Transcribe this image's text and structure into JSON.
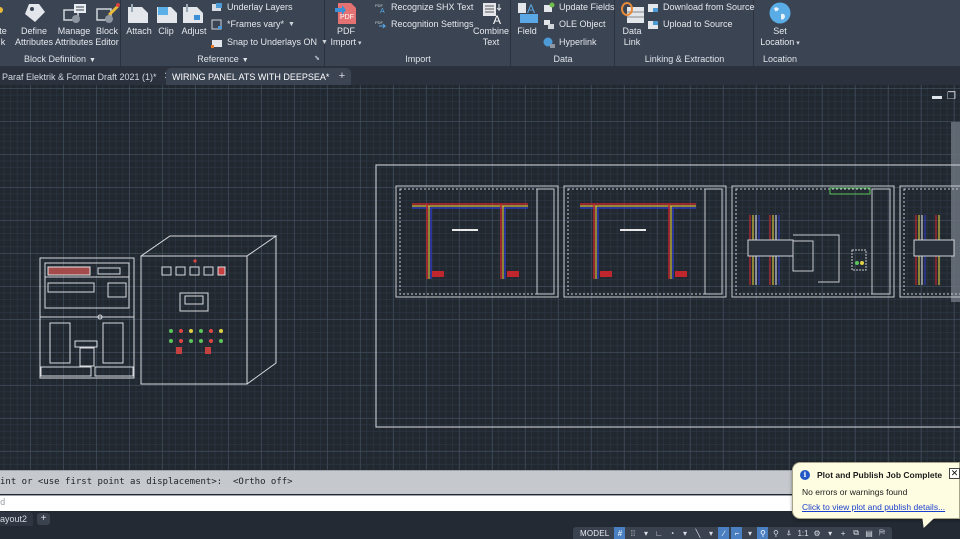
{
  "ribbon": {
    "panels": {
      "block_definition": {
        "title": "Block Definition",
        "buttons": [
          {
            "label_line1": "te",
            "label_line2": "k"
          },
          {
            "label_line1": "Define",
            "label_line2": "Attributes"
          },
          {
            "label_line1": "Manage",
            "label_line2": "Attributes"
          },
          {
            "label_line1": "Block",
            "label_line2": "Editor"
          }
        ]
      },
      "reference": {
        "title": "Reference",
        "big_buttons": [
          "Attach",
          "Clip",
          "Adjust"
        ],
        "small_buttons": [
          "Underlay Layers",
          "*Frames vary*",
          "Snap to Underlays ON"
        ]
      },
      "import": {
        "title": "Import",
        "pdf_import": {
          "label_line1": "PDF",
          "label_line2": "Import",
          "icon_text": "PDF"
        },
        "small_buttons": [
          "Recognize SHX Text",
          "Recognition Settings"
        ],
        "combine_text": {
          "label_line1": "Combine",
          "label_line2": "Text"
        }
      },
      "data": {
        "title": "Data",
        "field": "Field",
        "small_buttons": [
          "Update Fields",
          "OLE Object",
          "Hyperlink"
        ]
      },
      "linking": {
        "title": "Linking & Extraction",
        "data_link": {
          "label_line1": "Data",
          "label_line2": "Link"
        },
        "small_buttons": [
          "Download from Source",
          "Upload to Source"
        ]
      },
      "location": {
        "title": "Location",
        "set_location": {
          "label_line1": "Set",
          "label_line2": "Location"
        }
      }
    }
  },
  "file_tabs": [
    {
      "label": "Paraf Elektrik & Format Draft 2021 (1)*",
      "active": false
    },
    {
      "label": "WIRING PANEL ATS WITH DEEPSEA*",
      "active": true
    }
  ],
  "new_tab_symbol": "+",
  "close_symbol": "✕",
  "command_line": {
    "history": "int or <use first point as displacement>:  <Ortho off>",
    "input_placeholder": "d"
  },
  "layout_tabs": [
    {
      "label": "ayout2"
    }
  ],
  "layout_add_symbol": "+",
  "status_bar": {
    "model_label": "MODEL",
    "annotation_scale": "1:1",
    "items": [
      "grid",
      "snap",
      "ortho",
      "polar",
      "osnap-tracking",
      "lineweight",
      "transparency",
      "annotation-visibility",
      "auto-scale",
      "annotation-scale",
      "workspace",
      "plus",
      "isolate",
      "plot-status",
      "communication"
    ]
  },
  "notification": {
    "title": "Plot and Publish Job Complete",
    "message": "No errors or warnings found",
    "link": "Click to view plot and publish details...",
    "info_symbol": "i",
    "close_symbol": "✕"
  },
  "colors": {
    "ribbon_bg": "#3b4453",
    "canvas_bg": "#212830",
    "accent_blue": "#4a7fc1",
    "balloon_bg": "#fffde1",
    "wire_red": "#c0262d",
    "wire_yellow": "#d4c23a",
    "wire_blue": "#2e3bb8"
  }
}
